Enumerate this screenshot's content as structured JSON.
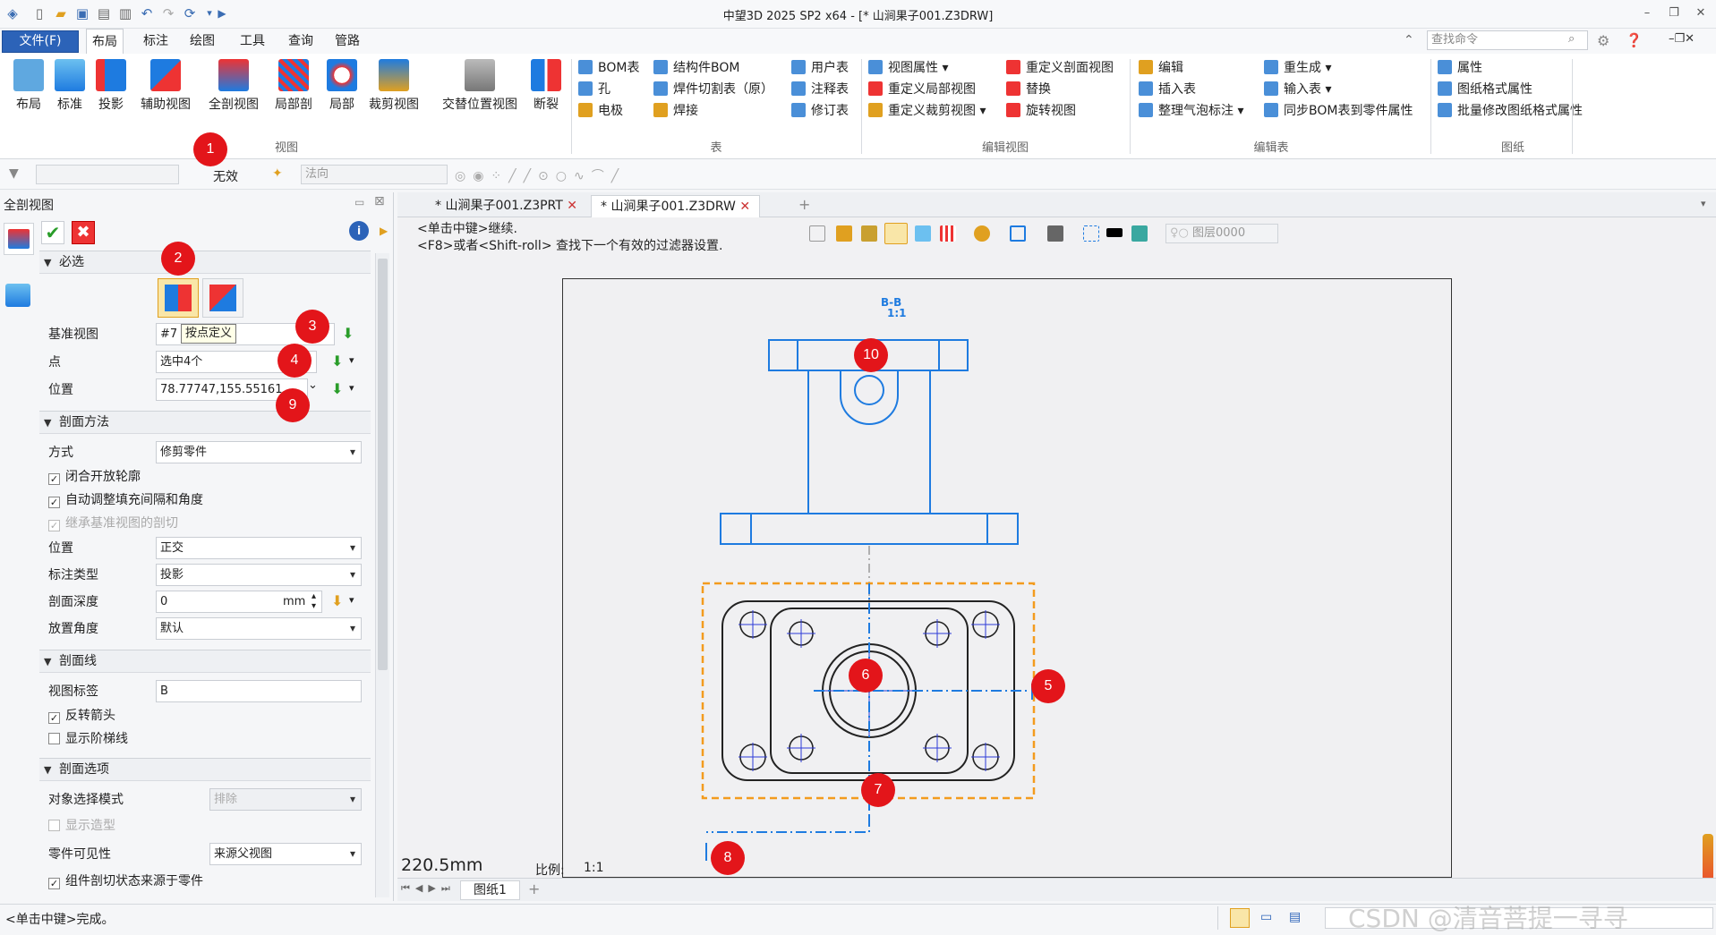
{
  "titlebar": {
    "title": "中望3D 2025 SP2 x64 - [* 山涧果子001.Z3DRW]"
  },
  "menu": {
    "file": "文件(F)",
    "tabs": [
      "布局",
      "标注",
      "绘图",
      "工具",
      "查询",
      "管路"
    ],
    "active_tab": "布局",
    "search_placeholder": "查找命令"
  },
  "ribbon": {
    "view_group": {
      "label": "视图",
      "buttons": [
        "布局",
        "标准",
        "投影",
        "辅助视图",
        "全剖视图",
        "局部剖",
        "局部",
        "裁剪视图",
        "交替位置视图",
        "断裂"
      ]
    },
    "table_group": {
      "label": "表",
      "items": [
        "BOM表",
        "结构件BOM",
        "用户表",
        "孔",
        "焊件切割表（原）",
        "注释表",
        "电极",
        "焊接",
        "修订表"
      ]
    },
    "edit_view_group": {
      "label": "编辑视图",
      "items": [
        "视图属性",
        "重定义剖面视图",
        "重定义局部视图",
        "替换",
        "重定义裁剪视图",
        "旋转视图"
      ]
    },
    "edit_table_group": {
      "label": "编辑表",
      "items": [
        "编辑",
        "重生成",
        "插入表",
        "输入表",
        "整理气泡标注",
        "同步BOM表到零件属性"
      ]
    },
    "sheet_group": {
      "label": "图纸",
      "items": [
        "属性",
        "图纸格式属性",
        "批量修改图纸格式属性"
      ]
    }
  },
  "filterbar": {
    "invalid": "无效",
    "direction": "法向"
  },
  "panel": {
    "title": "全剖视图",
    "required": "必选",
    "base_view_label": "基准视图",
    "base_view_value": "#7",
    "tooltip": "按点定义",
    "point_label": "点",
    "point_value": "选中4个",
    "position_label": "位置",
    "position_value": "78.77747,155.55161",
    "method_section": "剖面方法",
    "mode_label": "方式",
    "mode_value": "修剪零件",
    "close_open": "闭合开放轮廓",
    "auto_adjust": "自动调整填充间隔和角度",
    "inherit_cut": "继承基准视图的剖切",
    "pos_label": "位置",
    "pos_value": "正交",
    "label_type": "标注类型",
    "label_type_value": "投影",
    "depth_label": "剖面深度",
    "depth_value": "0",
    "depth_unit": "mm",
    "angle_label": "放置角度",
    "angle_value": "默认",
    "line_section": "剖面线",
    "view_label": "视图标签",
    "view_label_value": "B",
    "reverse_arrow": "反转箭头",
    "show_step": "显示阶梯线",
    "options_section": "剖面选项",
    "select_mode": "对象选择模式",
    "select_mode_value": "排除",
    "show_shape": "显示造型",
    "part_visibility": "零件可见性",
    "part_visibility_value": "来源父视图",
    "component_state": "组件剖切状态来源于零件"
  },
  "doc_tabs": [
    "* 山涧果子001.Z3PRT",
    "* 山涧果子001.Z3DRW"
  ],
  "prompt": {
    "line1": "<单击中键>继续.",
    "line2": "<F8>或者<Shift-roll> 查找下一个有效的过滤器设置."
  },
  "drawing": {
    "view_title": "B-B",
    "view_scale": "1:1",
    "layer": "图层0000",
    "dimension": "220.5mm",
    "scale_label": "比例:",
    "scale_value": "1:1",
    "sheet_tab": "图纸1"
  },
  "markers": [
    "1",
    "2",
    "3",
    "4",
    "5",
    "6",
    "7",
    "8",
    "9",
    "10"
  ],
  "status": {
    "text": "<单击中键>完成。",
    "watermark": "CSDN @清音菩提一寻寻"
  },
  "colors": {
    "accent": "#2c63b8",
    "marker": "#e3151a",
    "geometry": "#1e7be0",
    "selection": "#f39b1e"
  }
}
